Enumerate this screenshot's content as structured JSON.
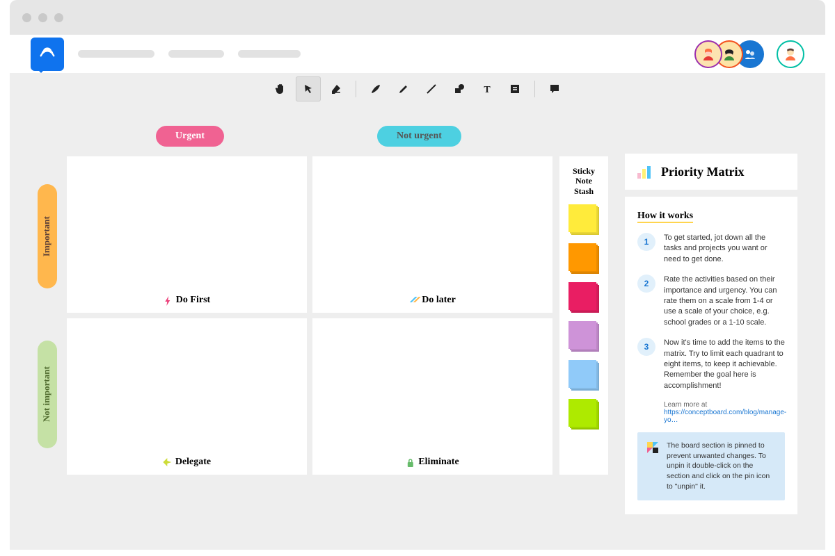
{
  "matrix": {
    "col_headers": [
      "Urgent",
      "Not urgent"
    ],
    "row_headers": [
      "Important",
      "Not important"
    ],
    "cells": {
      "q1": "Do First",
      "q2": "Do later",
      "q3": "Delegate",
      "q4": "Eliminate"
    }
  },
  "stash": {
    "title": "Sticky Note Stash",
    "colors": [
      "#ffeb3b",
      "#ff9800",
      "#e91e63",
      "#ce93d8",
      "#90caf9",
      "#aeea00"
    ]
  },
  "panel": {
    "title": "Priority Matrix",
    "how_title": "How it works",
    "steps": [
      "To get started, jot down all the tasks and projects you want or need to get done.",
      "Rate the activities based on their importance and urgency. You can rate them on a scale from 1-4 or use a scale of your choice, e.g. school grades or a 1-10 scale.",
      "Now it's time to add the items to the matrix. Try to limit each quadrant to eight items, to keep it achievable. Remember the goal here is accomplishment!"
    ],
    "learn_prefix": "Learn more at",
    "learn_link": "https://conceptboard.com/blog/manage-yo…",
    "info": "The board section is pinned to prevent unwanted changes. To unpin it double-click on the section and click on the pin icon to \"unpin\" it."
  }
}
